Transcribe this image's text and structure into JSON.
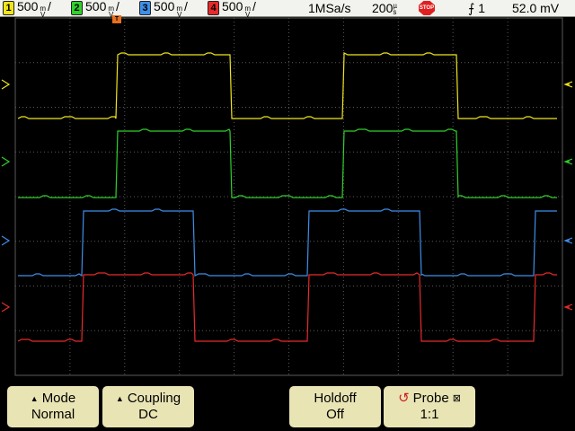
{
  "status_bar": {
    "channels": [
      {
        "number": "1",
        "scale": "500",
        "unit_top": "m",
        "unit_bottom": "V",
        "color": "#f0e51a"
      },
      {
        "number": "2",
        "scale": "500",
        "unit_top": "m",
        "unit_bottom": "V",
        "color": "#2fd12a"
      },
      {
        "number": "3",
        "scale": "500",
        "unit_top": "m",
        "unit_bottom": "V",
        "color": "#3d8fe8"
      },
      {
        "number": "4",
        "scale": "500",
        "unit_top": "m",
        "unit_bottom": "V",
        "color": "#e82a2a"
      }
    ],
    "sample_rate": "1MSa/s",
    "timebase": "200",
    "timebase_unit_top": "µ",
    "timebase_unit_bottom": "s",
    "run_state": "STOP",
    "trigger_source": "1",
    "trigger_level": "52.0 mV"
  },
  "waveform_colors": {
    "ch1": "#f0e51a",
    "ch2": "#2fd12a",
    "ch3": "#3d8fe8",
    "ch4": "#e82a2a",
    "trigger_marker": "#e87020",
    "grid": "#5a5a5a"
  },
  "softkeys": {
    "mode": {
      "title": "Mode",
      "value": "Normal"
    },
    "coupling": {
      "title": "Coupling",
      "value": "DC"
    },
    "holdoff": {
      "title": "Holdoff",
      "value": "Off"
    },
    "probe": {
      "title": "Probe",
      "value": "1:1"
    }
  }
}
